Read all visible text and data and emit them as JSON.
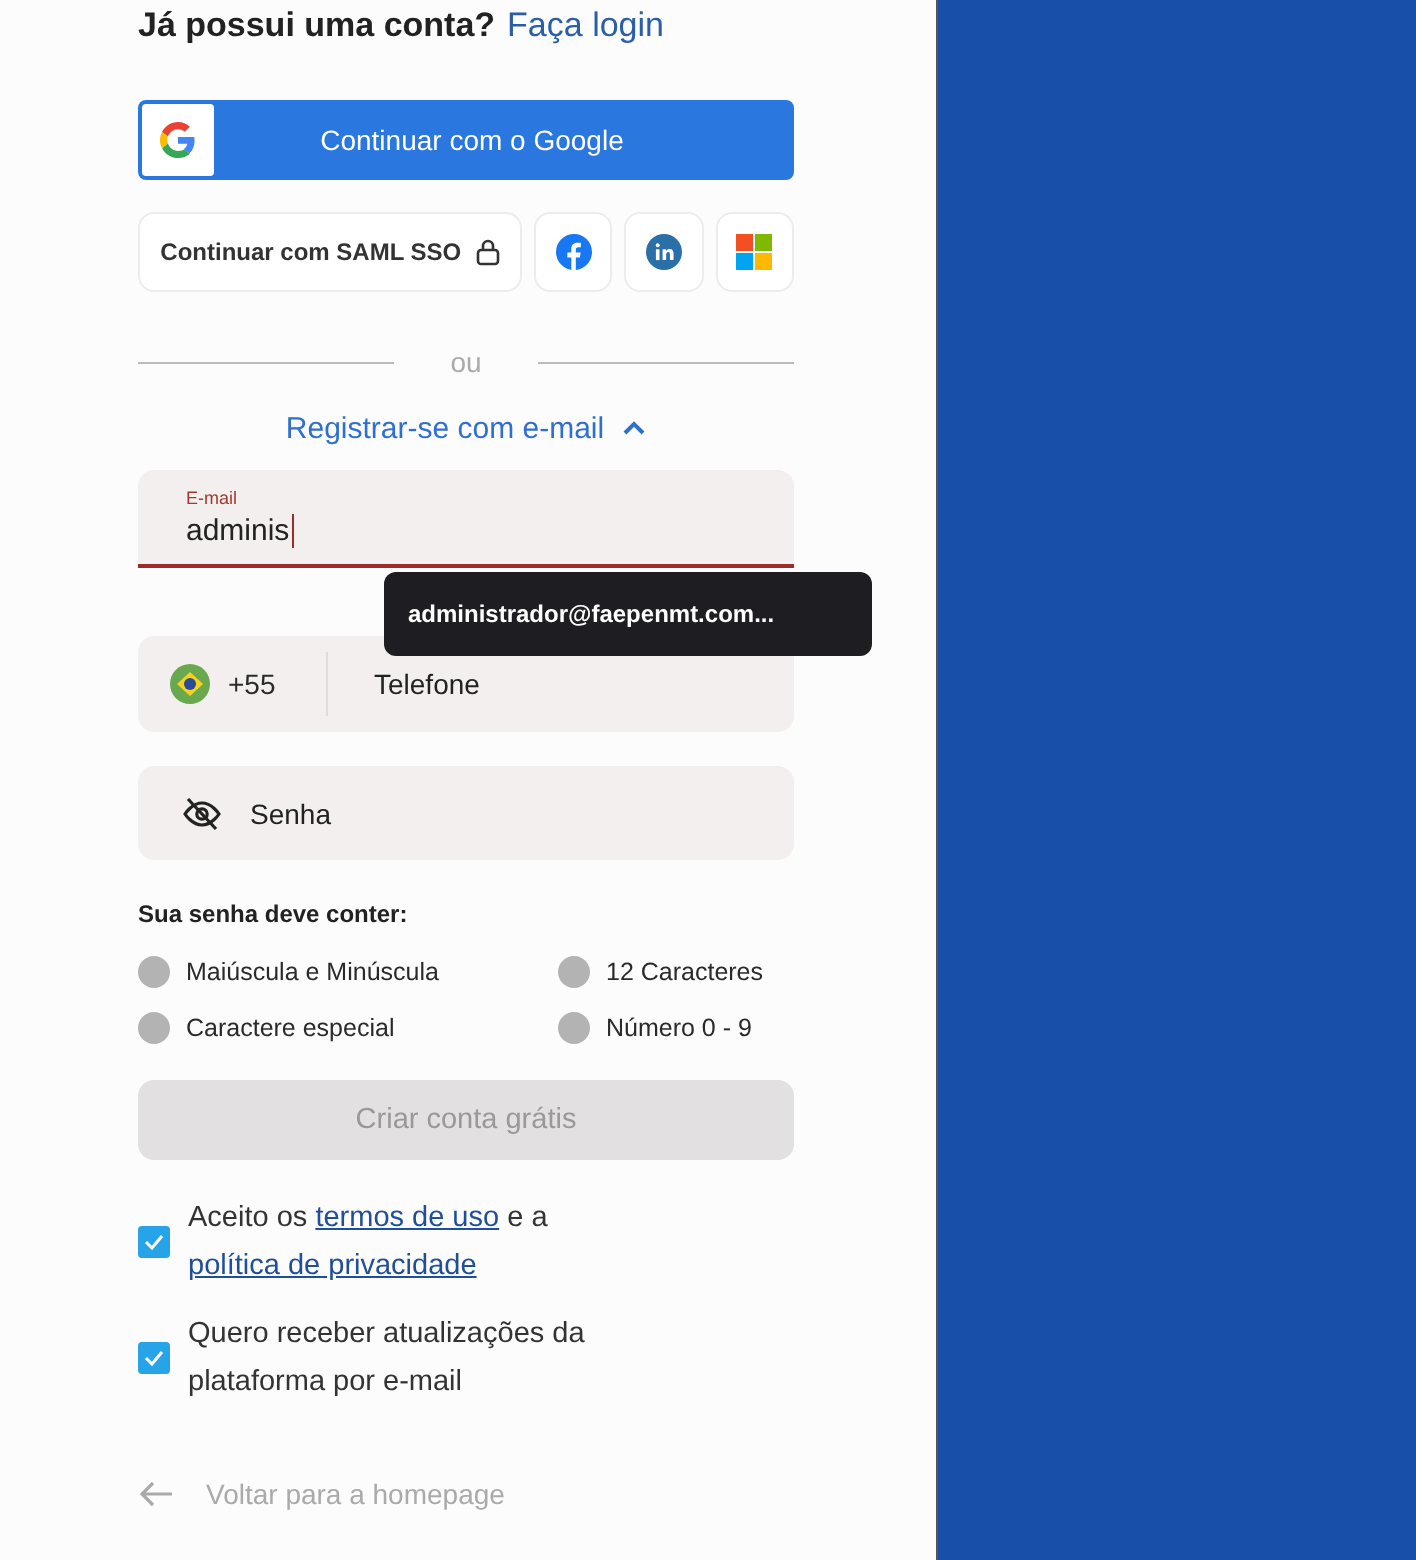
{
  "login_prompt": {
    "question": "Já possui uma conta?",
    "link": "Faça login"
  },
  "google_button": {
    "label": "Continuar com o Google"
  },
  "sso_buttons": [
    {
      "kind": "saml",
      "label": "Continuar com SAML SSO"
    },
    {
      "kind": "facebook"
    },
    {
      "kind": "linkedin"
    },
    {
      "kind": "microsoft"
    }
  ],
  "divider": {
    "label": "ou"
  },
  "email_toggle": {
    "label": "Registrar-se com e-mail",
    "expanded": true
  },
  "email_field": {
    "label": "E-mail",
    "value": "adminis",
    "focused": true
  },
  "autocomplete_tooltip": {
    "text": "administrador@faepenmt.com..."
  },
  "phone_field": {
    "country_code": "+55",
    "placeholder": "Telefone"
  },
  "password_field": {
    "placeholder": "Senha"
  },
  "password_rules": {
    "title": "Sua senha deve conter:",
    "items": [
      {
        "label": "Maiúscula e Minúscula",
        "met": false
      },
      {
        "label": "12 Caracteres",
        "met": false
      },
      {
        "label": "Caractere especial",
        "met": false
      },
      {
        "label": "Número 0 - 9",
        "met": false
      }
    ]
  },
  "submit_button": {
    "label": "Criar conta grátis",
    "disabled": true
  },
  "consents": [
    {
      "checked": true,
      "parts": [
        {
          "kind": "text",
          "text": "Aceito os"
        },
        {
          "kind": "link",
          "text": "termos de uso"
        },
        {
          "kind": "text",
          "text": "e a"
        },
        {
          "kind": "link",
          "text": "política de privacidade"
        }
      ]
    },
    {
      "checked": true,
      "parts": [
        {
          "kind": "text",
          "text": "Quero receber atualizações da plataforma por e-mail"
        }
      ]
    }
  ],
  "back_link": {
    "label": "Voltar para a homepage"
  }
}
